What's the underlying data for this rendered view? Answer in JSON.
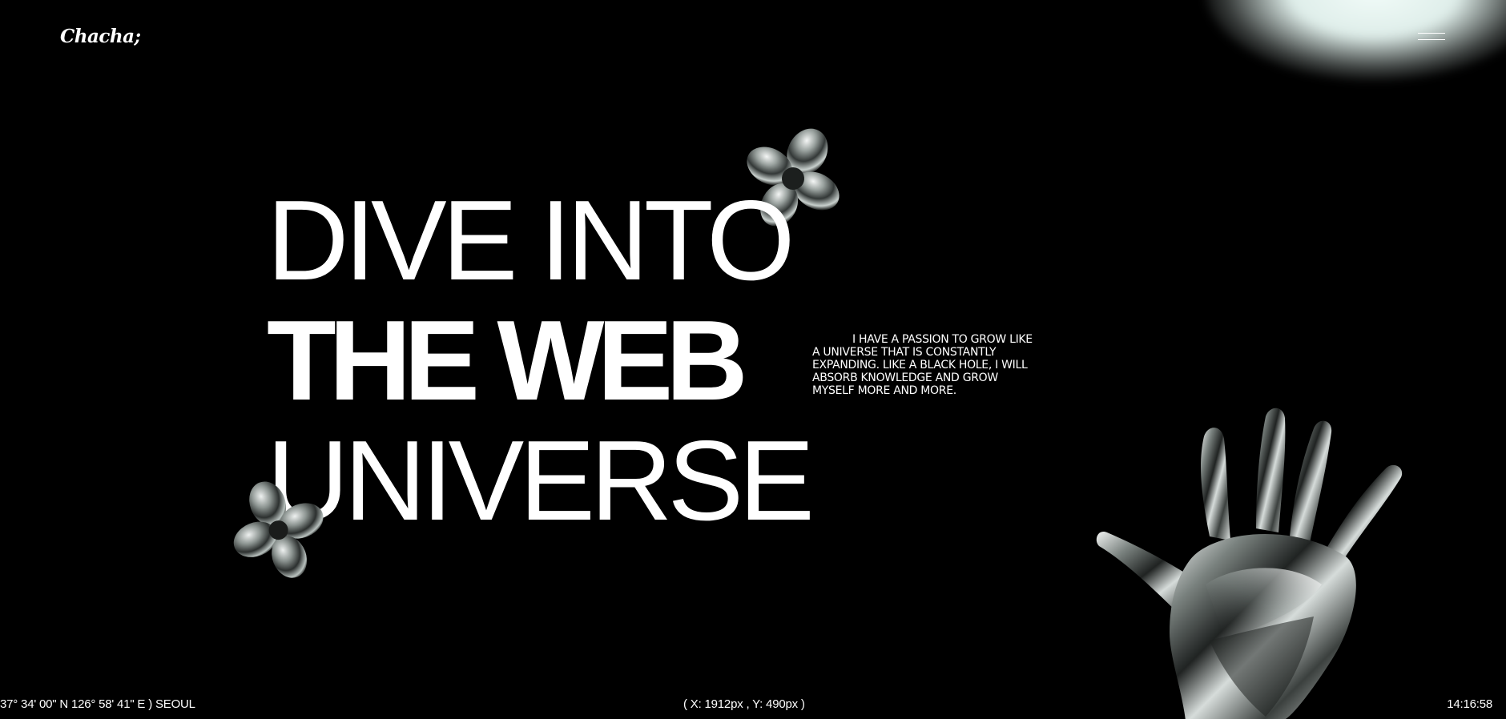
{
  "brand": {
    "logo": "Chacha;"
  },
  "header": {
    "menu_icon": "hamburger-menu-icon"
  },
  "hero": {
    "lines": [
      "DIVE INTO",
      "THE WEB",
      "UNIVERSE"
    ],
    "intro": "I HAVE A PASSION TO GROW LIKE A UNIVERSE THAT IS CONSTANTLY EXPANDING. LIKE A BLACK HOLE, I WILL ABSORB KNOWLEDGE AND GROW MYSELF MORE AND MORE."
  },
  "decor": {
    "top_icon": "chrome-clover-flower",
    "bottom_icon": "chrome-clover-flower",
    "hand_icon": "chrome-hand-sculpture",
    "glow_color": "#e8f6f2"
  },
  "footer": {
    "location": "37° 34' 00\" N 126° 58' 41\" E ) SEOUL",
    "cursor": "( X: 1912px , Y: 490px )",
    "time": "14:16:58"
  }
}
